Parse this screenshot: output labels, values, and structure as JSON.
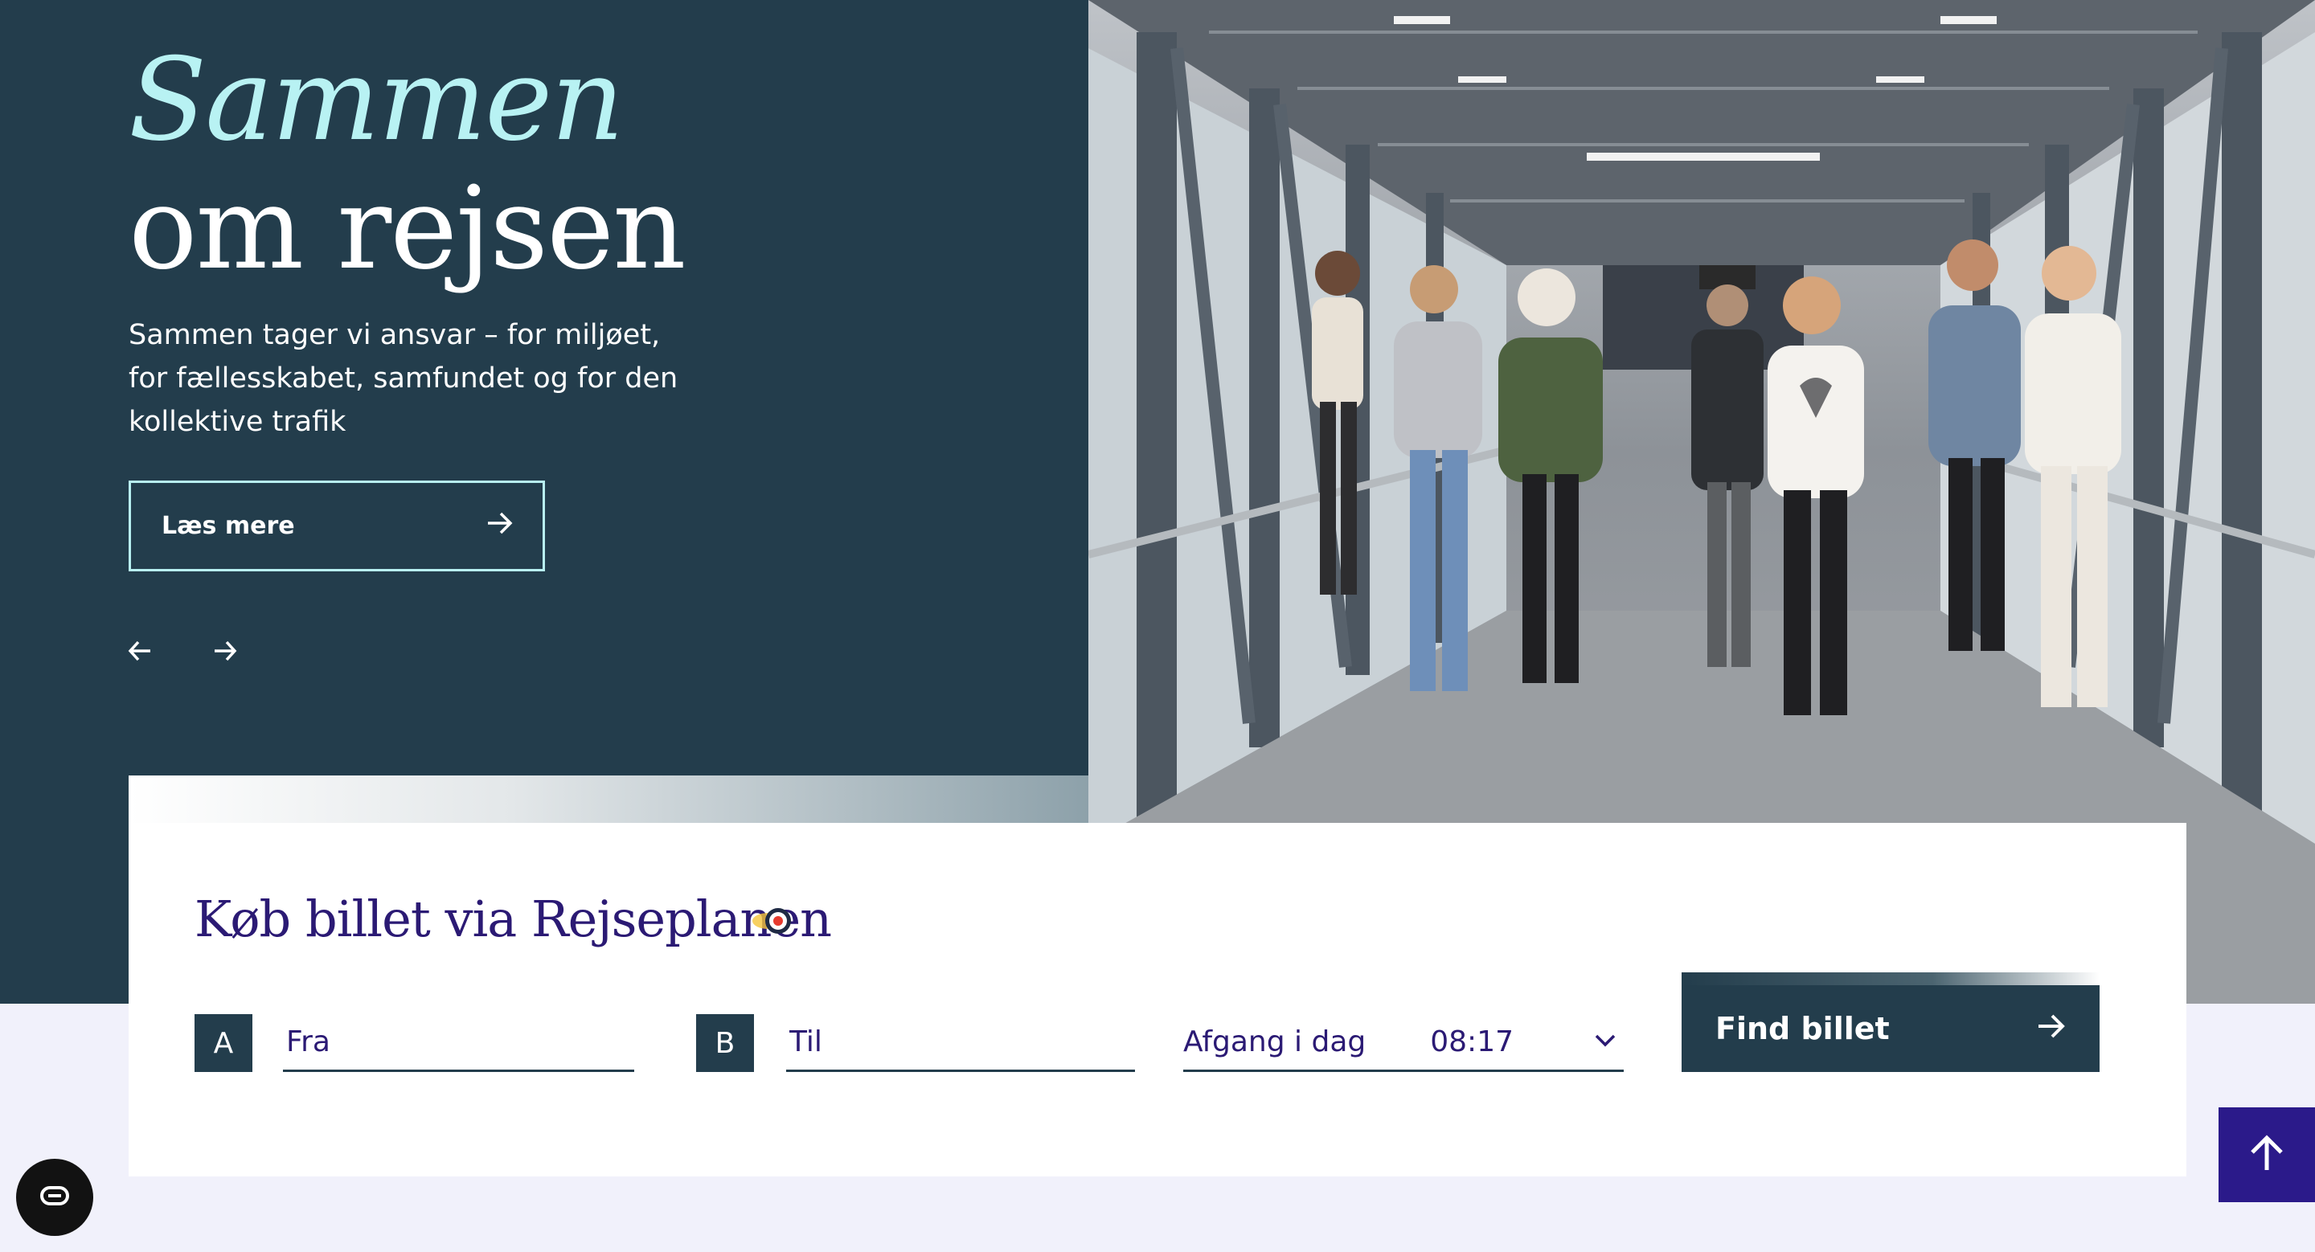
{
  "hero": {
    "title_line1": "Sammen",
    "title_line2": "om rejsen",
    "lead": "Sammen tager vi ansvar – for miljøet, for fællesskabet, samfundet og for den kollektive trafik",
    "read_more_label": "Læs mere",
    "prev_icon": "arrow-left-icon",
    "next_icon": "arrow-right-icon"
  },
  "ticket": {
    "title": "Køb billet via Rejseplanen",
    "from_badge": "A",
    "from_placeholder": "Fra",
    "to_badge": "B",
    "to_placeholder": "Til",
    "departure_label": "Afgang i dag",
    "departure_time": "08:17",
    "find_label": "Find billet"
  },
  "colors": {
    "hero_bg": "#233d4c",
    "accent_mint": "#b8f2f3",
    "heading_purple": "#2b1a74",
    "page_bg": "#f1f1fb",
    "to_top_bg": "#2b1a8a"
  },
  "icons": {
    "to_top": "arrow-up-icon",
    "cookie": "cookie-settings-icon",
    "logo": "rejseplanen-logo-icon"
  }
}
